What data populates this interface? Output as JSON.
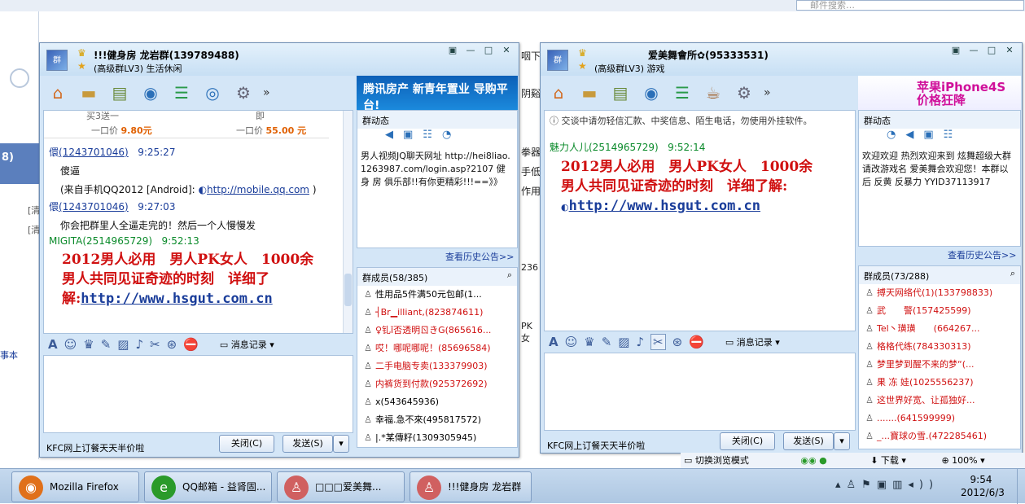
{
  "browser": {
    "search_placeholder": "邮件搜索…",
    "left_badge": "8)",
    "left_link1": "[清",
    "left_link2": "[清",
    "left_item": "事本",
    "mid_lines": [
      "咽下",
      "阴谿",
      "拳器",
      "手低",
      "作用",
      "236",
      "PK女"
    ]
  },
  "win1": {
    "title": "!!!健身房 龙岩群(139789488)",
    "subtitle": "(高级群LV3) 生活休闲",
    "ad_text": "腾讯房产 新青年置业 导购平台!",
    "top_strip": {
      "col1": "买3送一",
      "col2": "即",
      "price_label": "一口价",
      "price1": "9.80元",
      "price2": "55.00 元"
    },
    "messages": [
      {
        "sender": "(1243701046)",
        "time": "9:25:27",
        "line1": "傻逼",
        "line2": "(来自手机QQ2012 [Android]:",
        "link": "http://mobile.qq.com",
        "line2_end": ")"
      },
      {
        "sender": "(1243701046)",
        "time": "9:27:03",
        "line1": "你会把群里人全逼走完的！然后一个人慢慢发"
      },
      {
        "sender": "MIGITA(2514965729)",
        "time": "9:52:13"
      }
    ],
    "spam_line1": "2012男人必用　男人PK女人　1000余",
    "spam_line2": "男人共同见证奇迹的时刻　详细了",
    "spam_line3": "解:",
    "spam_link": "http://www.hsgut.com.cn",
    "msg_record": "消息记录",
    "bottom_ad": "KFC网上订餐天天半价啦",
    "close_btn": "关闭(C)",
    "send_btn": "发送(S)",
    "dyn_title": "群动态",
    "dyn_text": "男人视频JQ聊天网址 http://hei8liao.1263987.com/login.asp?2107 健 身 房 俱乐部!!有你更精彩!!!==》》",
    "history": "查看历史公告>>",
    "members_title": "群成员(58/385)",
    "members": [
      {
        "name": "性用品5件满50元包邮(1...",
        "red": false
      },
      {
        "name": "┤Br▁illiant,(823874611)",
        "red": true
      },
      {
        "name": "♀钆ǐ否透明ㄖきG(865616...",
        "red": true
      },
      {
        "name": "哎！哪呢哪呢！(85696584)",
        "red": true
      },
      {
        "name": "二手电脑专卖(133379903)",
        "red": true
      },
      {
        "name": "内裤货到付款(925372692)",
        "red": true
      },
      {
        "name": "x(543645936)",
        "red": false
      },
      {
        "name": "幸福.急不來(495817572)",
        "red": false
      },
      {
        "name": "|.*某傳籽(1309305945)",
        "red": false
      }
    ]
  },
  "win2": {
    "title": "爱美舞會所✿(95333531)",
    "subtitle": "(高级群LV3) 游戏",
    "ad_text": "苹果iPhone4S 价格狂降",
    "notice": "交谈中请勿轻信汇款、中奖信息、陌生电话，勿使用外挂软件。",
    "sender": "魅力人儿(2514965729)",
    "time": "9:52:14",
    "spam_line1": "2012男人必用　男人PK女人　1000余",
    "spam_line2": "男人共同见证奇迹的时刻　详细了解:",
    "spam_link": "http://www.hsgut.com.cn",
    "msg_record": "消息记录",
    "bottom_ad": "KFC网上订餐天天半价啦",
    "close_btn": "关闭(C)",
    "send_btn": "发送(S)",
    "dyn_title": "群动态",
    "dyn_text": "欢迎欢迎 热烈欢迎来到 炫舞超级大群 请改游戏名 爱美舞会欢迎您！本群以后 反黄 反暴力 YYID37113917",
    "history": "查看历史公告>>",
    "members_title": "群成员(73/288)",
    "members": [
      {
        "name": "搏天网络代(1)(133798833)",
        "red": true
      },
      {
        "name": "武　　警(157425599)",
        "red": true
      },
      {
        "name": "Tel丶璜璜　　(664267...",
        "red": true
      },
      {
        "name": "格格代练(784330313)",
        "red": true
      },
      {
        "name": "梦里梦到醒不来的梦“(...",
        "red": true
      },
      {
        "name": "果 冻 娃(1025556237)",
        "red": true
      },
      {
        "name": "这世界好宽、让孤独好...",
        "red": true
      },
      {
        "name": ".......(641599999)",
        "red": true
      },
      {
        "name": "_...寶球の雪.(472285461)",
        "red": true
      }
    ]
  },
  "statusbar": {
    "mode": "切换浏览模式",
    "download": "下载",
    "zoom": "100%"
  },
  "taskbar": {
    "items": [
      {
        "label": "Mozilla Firefox",
        "color": "#e0701a"
      },
      {
        "label": "QQ邮箱 - 益肾固...",
        "color": "#2a9a2a"
      },
      {
        "label": "□□□爱美舞...",
        "color": "#d06060"
      },
      {
        "label": "!!!健身房 龙岩群",
        "color": "#d06060"
      }
    ],
    "time": "9:54",
    "date": "2012/6/3"
  }
}
